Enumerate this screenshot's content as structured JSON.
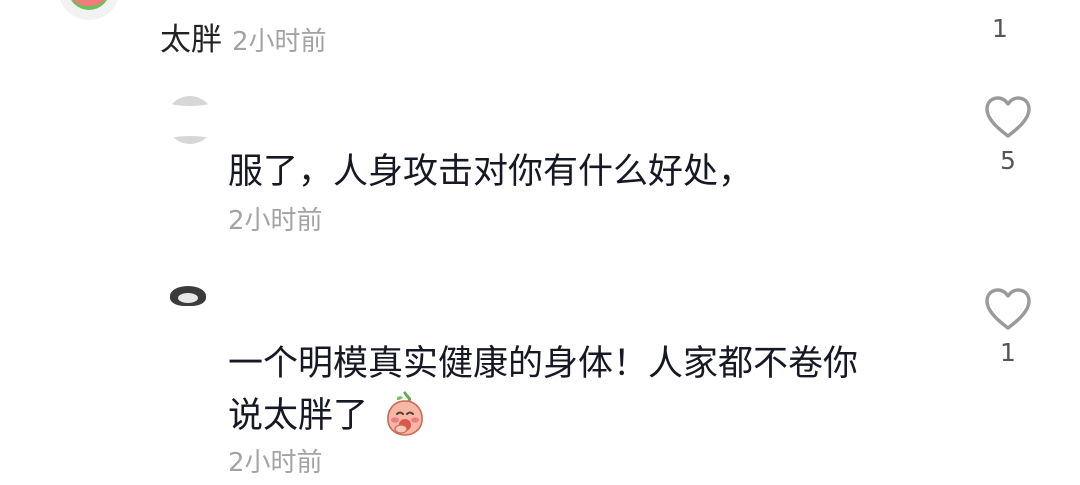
{
  "top_comment": {
    "text": "太胖",
    "time": "2小时前",
    "like_count": "1"
  },
  "replies": [
    {
      "text_lines": [
        "服了，人身攻击对你有什么好处，"
      ],
      "time": "2小时前",
      "like_count": "5"
    },
    {
      "text_lines": [
        "一个明模真实健康的身体！人家都不卷你",
        "说太胖了"
      ],
      "time": "2小时前",
      "like_count": "1",
      "emoji": "blushing-peach-emoji"
    }
  ],
  "icons": {
    "like": "heart-outline-icon"
  },
  "colors": {
    "text": "#161823",
    "meta": "#a3a3a3",
    "heart_stroke": "#9a9a9a"
  }
}
